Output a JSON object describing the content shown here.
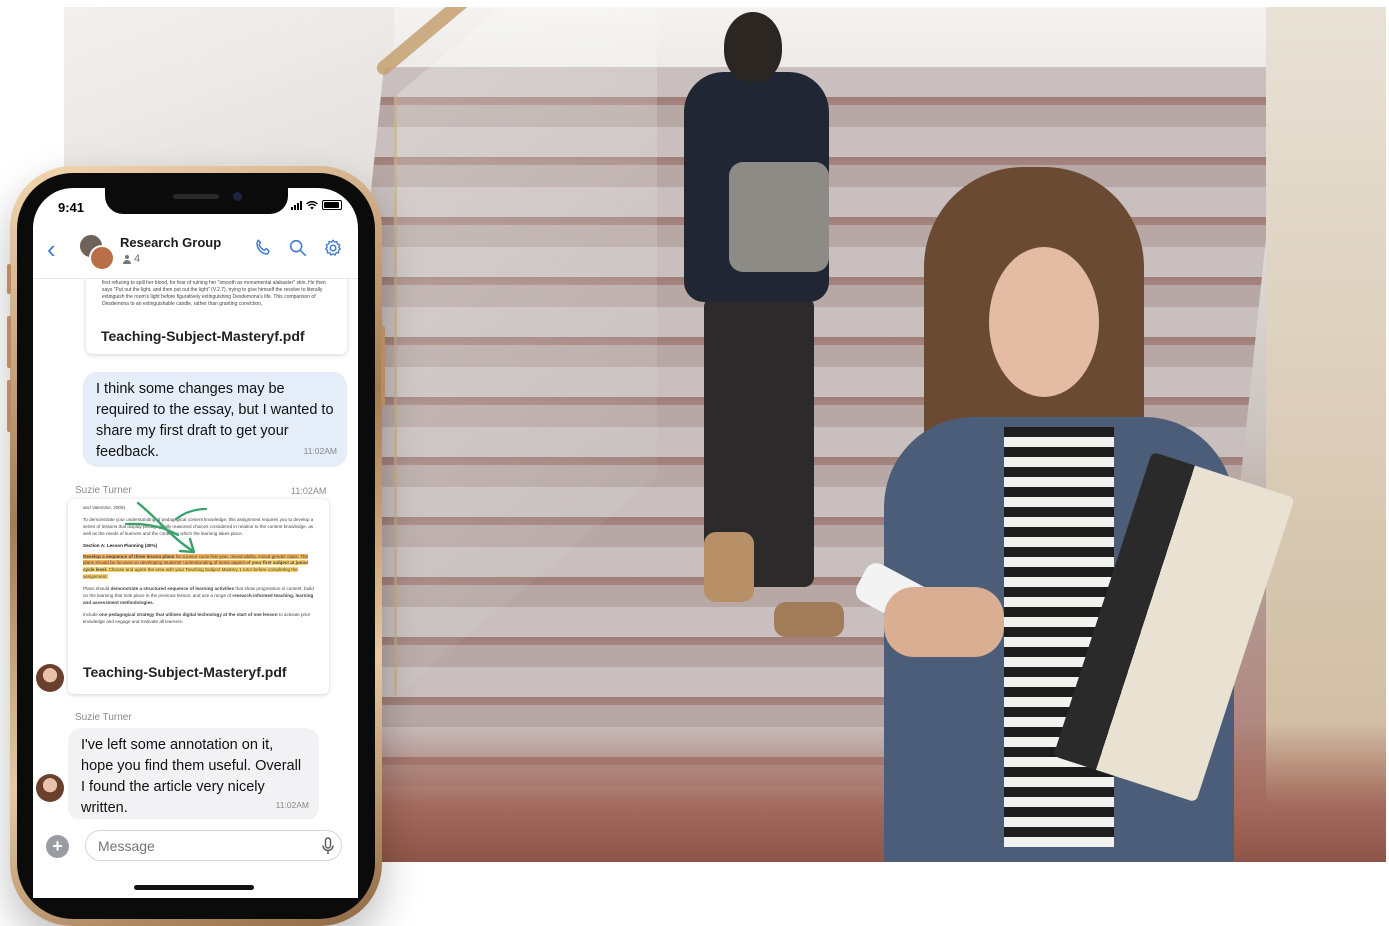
{
  "status_bar": {
    "time": "9:41"
  },
  "header": {
    "title": "Research Group",
    "member_count": "4"
  },
  "messages": {
    "file1": {
      "preview_text": "speeches made by Iago throughout the play. Othello, like Iago, objectifies Desdemona several times, first refusing to spill her blood, for fear of ruining her \"smooth as monumental alabaster\" skin. He then says \"Put out the light, and then put out the light\" (V.2.7), trying to give himself the resolve to literally extinguish the room's light before figuratively extinguishing Desdemona's life. This comparison of Desdemona to an extinguishable candle, rather than granting conviction,",
      "filename": "Teaching-Subject-Masteryf.pdf"
    },
    "outgoing1": {
      "text": "I think some changes may be required to the essay, but I wanted to share my first draft to get your feedback.",
      "time": "11:02AM"
    },
    "file2": {
      "sender": "Suzie Turner",
      "time": "11:02AM",
      "preview": {
        "line0": "and Valentine, 2009).",
        "para1": "To demonstrate your understanding of pedagogical content knowledge, this assignment requires you to develop a series of lessons that display pedagogically reasoned choices considered in relation to the content knowledge, as well as the needs of learners and the context in which the learning takes place.",
        "section": "Section A: Lesson Planning (30%)",
        "hl1": "Develop a sequence of three lesson plans",
        "hl2": " for a junior cycle first year, mixed-ability, mixed gender class. The plans should be focused on developing students' understanding of some aspect ",
        "hl3": "of your first subject at junior cycle level.",
        "hl4": " Choose and agree the area with your Teaching Subject Mastery 1 tutor before completing the assignment.",
        "para2a": "Plans should ",
        "para2b": "demonstrate a structured sequence of learning activities",
        "para2c": " that show progression in content, build on the learning that took place in the previous lesson, and use a range of ",
        "para2d": "research-informed teaching, learning and assessment methodologies.",
        "para3a": "Include ",
        "para3b": "one pedagogical strategy that utilises digital technology at the start of one lesson",
        "para3c": " to activate prior knowledge and engage and motivate all learners."
      },
      "filename": "Teaching-Subject-Masteryf.pdf"
    },
    "incoming1": {
      "sender": "Suzie Turner",
      "text": "I've left some annotation on it, hope you find them useful. Overall I found the article very nicely written.",
      "time": "11:02AM"
    }
  },
  "composer": {
    "placeholder": "Message"
  },
  "colors": {
    "accent": "#3f7bd4",
    "outgoing_bubble": "#e5edf9",
    "incoming_bubble": "#f2f2f4",
    "annotation_green": "#3aa36b",
    "highlight_orange": "#f7b55b"
  },
  "icons": [
    "back-icon",
    "phone-icon",
    "search-icon",
    "gear-icon",
    "person-icon",
    "plus-icon",
    "mic-icon",
    "signal-icon",
    "wifi-icon",
    "battery-icon"
  ]
}
